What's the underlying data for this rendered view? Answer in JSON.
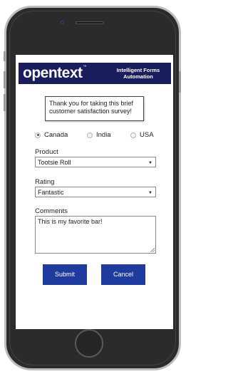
{
  "brand": {
    "logo_text": "opentext",
    "tagline": "Intelligent Forms Automation"
  },
  "survey": {
    "intro": "Thank you for taking this brief customer satisfaction survey!"
  },
  "country": {
    "options": [
      {
        "label": "Canada",
        "selected": true
      },
      {
        "label": "India",
        "selected": false
      },
      {
        "label": "USA",
        "selected": false
      }
    ]
  },
  "product": {
    "label": "Product",
    "value": "Tootsie Roll"
  },
  "rating": {
    "label": "Rating",
    "value": "Fantastic"
  },
  "comments": {
    "label": "Comments",
    "value": "This is my favorite bar!"
  },
  "actions": {
    "submit_label": "Submit",
    "cancel_label": "Cancel"
  },
  "colors": {
    "brand_bar": "#1a1d5c",
    "button": "#1f3b9e"
  }
}
